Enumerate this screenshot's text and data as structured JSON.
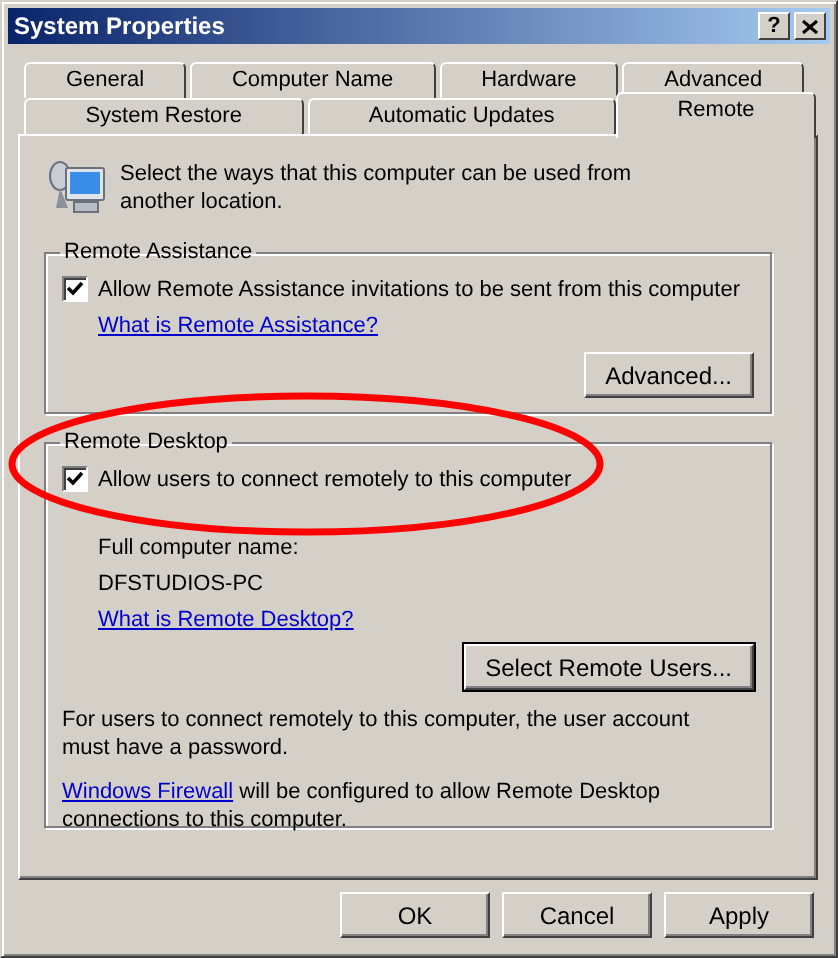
{
  "window": {
    "title": "System Properties",
    "help_button": "?"
  },
  "tab_rows": [
    {
      "tabs": [
        {
          "label": "General",
          "selected": false
        },
        {
          "label": "Computer Name",
          "selected": false
        },
        {
          "label": "Hardware",
          "selected": false
        },
        {
          "label": "Advanced",
          "selected": false
        }
      ]
    },
    {
      "tabs": [
        {
          "label": "System Restore",
          "selected": false
        },
        {
          "label": "Automatic Updates",
          "selected": false
        },
        {
          "label": "Remote",
          "selected": true
        }
      ]
    }
  ],
  "intro": "Select the ways that this computer can be used from another location.",
  "remote_assistance": {
    "title": "Remote Assistance",
    "checkbox": {
      "label": "Allow Remote Assistance invitations to be sent from this computer",
      "checked": true
    },
    "link": "What is Remote Assistance?",
    "button": "Advanced..."
  },
  "remote_desktop": {
    "title": "Remote Desktop",
    "checkbox": {
      "label": "Allow users to connect remotely to this computer",
      "checked": true
    },
    "name_label": "Full computer name:",
    "computer_name": "DFSTUDIOS-PC",
    "link": "What is Remote Desktop?",
    "button": "Select Remote Users...",
    "note": "For users to connect remotely to this computer, the user account must have a password.",
    "firewall_link": "Windows Firewall",
    "firewall_text": " will be configured to allow Remote Desktop connections to this computer."
  },
  "buttons": [
    "OK",
    "Cancel",
    "Apply"
  ]
}
